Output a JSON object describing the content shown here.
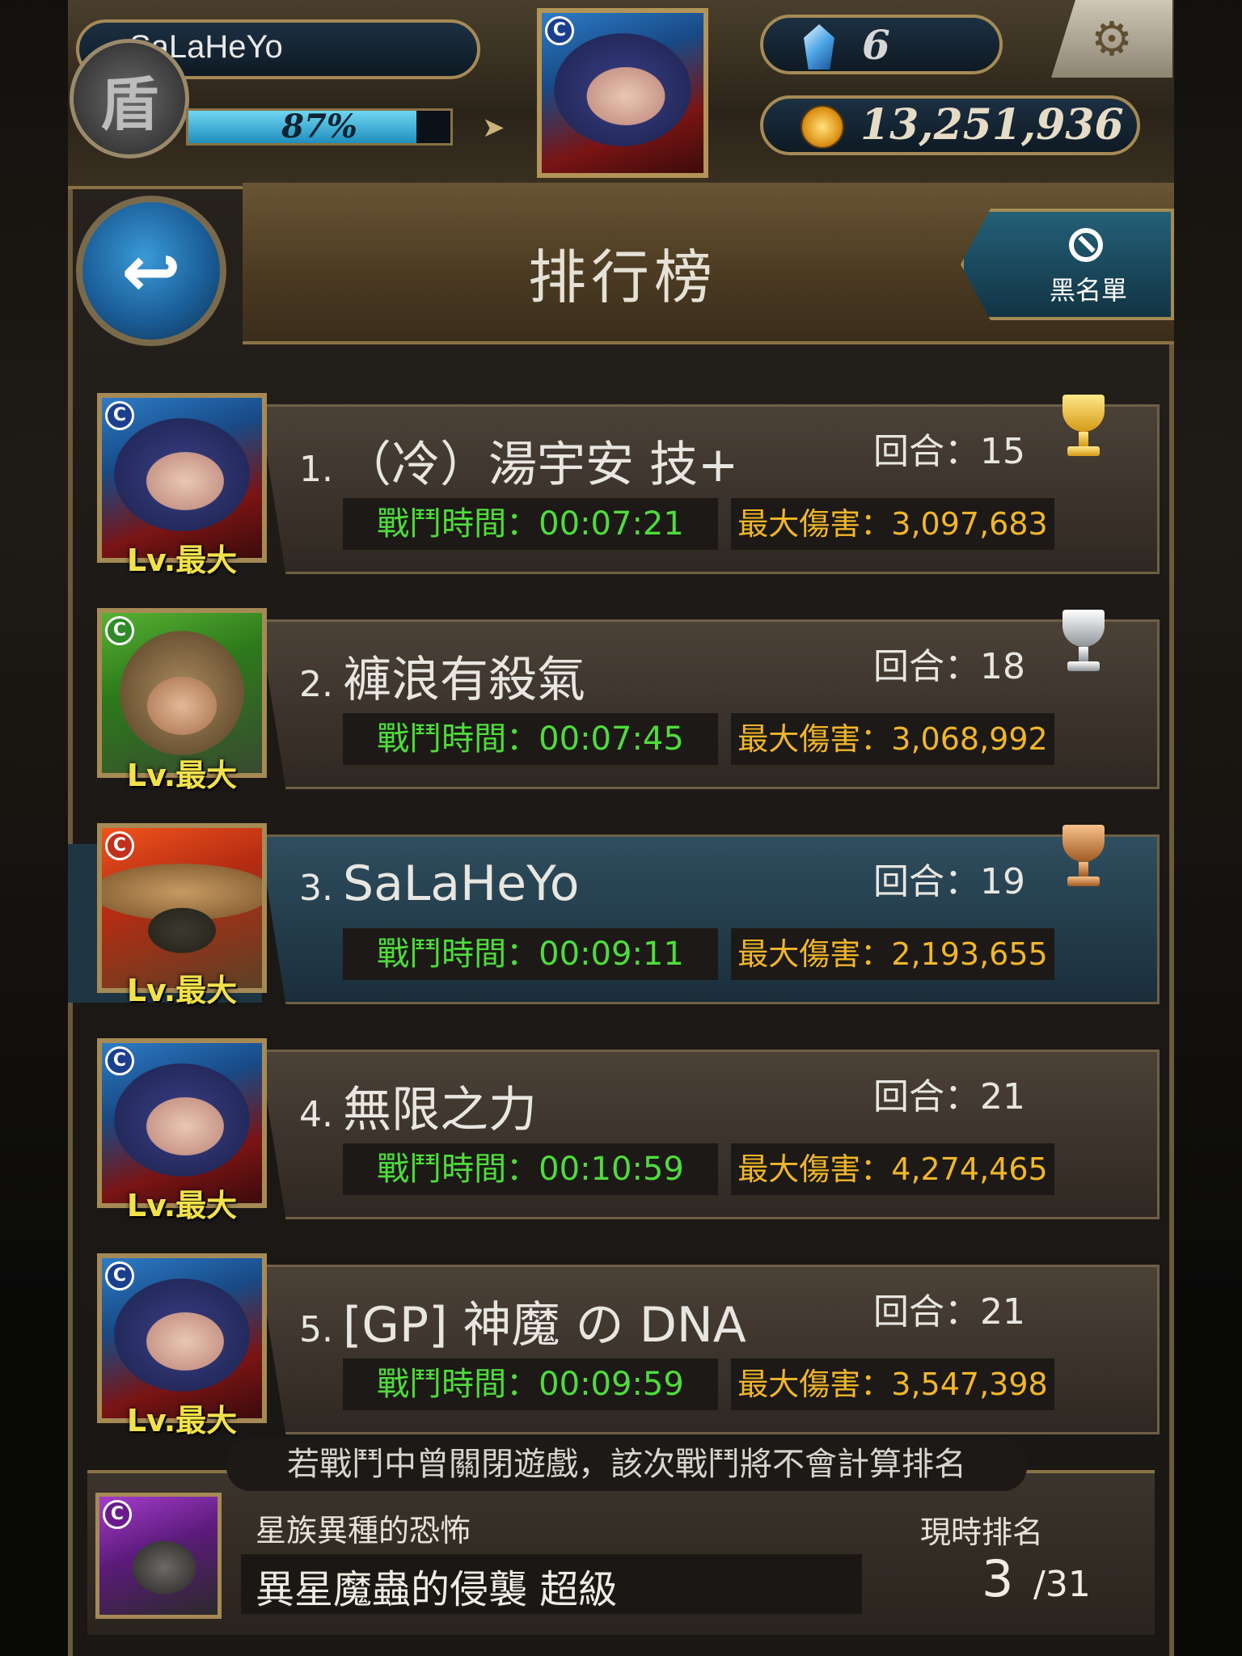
{
  "hud": {
    "player_name": "SaLaHeYo",
    "rank_badge_glyph": "盾",
    "exp_percent": 87,
    "exp_text": "87%",
    "gems": "6",
    "coins": "13,251,936",
    "settings_icon": "gear-icon"
  },
  "header": {
    "title": "排行榜",
    "back_icon": "back-arrow-icon",
    "blacklist_label": "黑名單",
    "blacklist_icon": "prohibited-icon"
  },
  "labels": {
    "turns_prefix": "回合：",
    "time_prefix": "戰鬥時間：",
    "damage_prefix": "最大傷害：",
    "level": "Lv.最大"
  },
  "rankings": [
    {
      "rank": "1.",
      "name": "（冷）湯宇安 技+",
      "turns": "15",
      "time": "00:07:21",
      "damage": "3,097,683",
      "trophy": "gold",
      "avatar": "blue-haired-heroine"
    },
    {
      "rank": "2.",
      "name": "褲浪有殺氣",
      "turns": "18",
      "time": "00:07:45",
      "damage": "3,068,992",
      "trophy": "silver",
      "avatar": "green-elf-heroine"
    },
    {
      "rank": "3.",
      "name": "SaLaHeYo",
      "turns": "19",
      "time": "00:09:11",
      "damage": "2,193,655",
      "trophy": "bronze",
      "avatar": "orange-hat-witch",
      "is_self": true
    },
    {
      "rank": "4.",
      "name": "無限之力",
      "turns": "21",
      "time": "00:10:59",
      "damage": "4,274,465",
      "trophy": "",
      "avatar": "blue-haired-heroine"
    },
    {
      "rank": "5.",
      "name": "[GP] 神魔 の DNA",
      "turns": "21",
      "time": "00:09:59",
      "damage": "3,547,398",
      "trophy": "",
      "avatar": "blue-haired-heroine"
    }
  ],
  "footer": {
    "notice": "若戰鬥中曾關閉遊戲，該次戰鬥將不會計算排名",
    "stage_name": "星族異種的恐怖",
    "quest_name": "異星魔蟲的侵襲 超級",
    "rank_label": "現時排名",
    "rank_current": "3",
    "rank_total": "/31"
  },
  "colors": {
    "accent_gold": "#a68a55",
    "time_green": "#4fdc3b",
    "damage_orange": "#f1b62a",
    "level_yellow": "#f2e24a",
    "self_row_teal": "#2f4e5f"
  }
}
